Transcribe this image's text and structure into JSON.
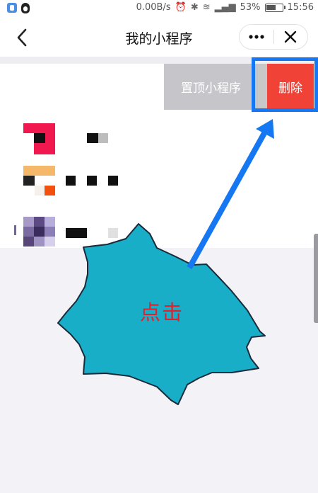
{
  "status_bar": {
    "speed": "0.00B/s",
    "battery": "53%",
    "time": "15:56"
  },
  "nav": {
    "title": "我的小程序",
    "back_icon": "chevron-left-icon",
    "more_icon": "more-dots-icon",
    "close_icon": "close-icon"
  },
  "swipe_actions": {
    "pin_label": "置顶小程序",
    "delete_label": "删除",
    "delete_color": "#f04236",
    "pin_color": "#c6c6ca"
  },
  "annotation": {
    "label": "点击",
    "arrow_color": "#1677f2",
    "burst_color": "#18aec8",
    "highlight_color": "#1677f2"
  }
}
